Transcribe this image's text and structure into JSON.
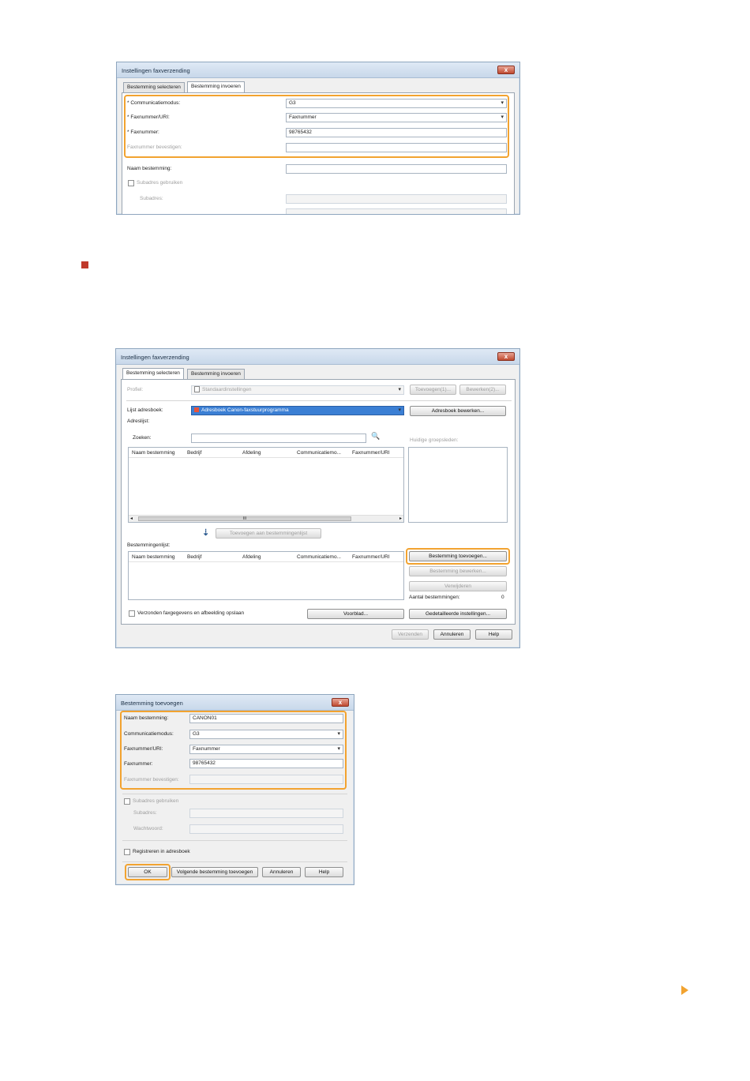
{
  "dialog1": {
    "title": "Instellingen faxverzending",
    "close": "x",
    "tabs": [
      "Bestemming selecteren",
      "Bestemming invoeren"
    ],
    "rows": [
      {
        "label": "* Communicatiemodus:",
        "value": "G3"
      },
      {
        "label": "* Faxnummer/URI:",
        "value": "Faxnummer"
      },
      {
        "label": "* Faxnummer:",
        "value": "98765432"
      },
      {
        "label": "Faxnummer bevestigen:",
        "value": ""
      }
    ],
    "naam_label": "Naam bestemming:",
    "subadres_check": "Subadres gebruiken",
    "subadres_label": "Subadres:"
  },
  "dialog2": {
    "title": "Instellingen faxverzending",
    "close": "x",
    "tabs": [
      "Bestemming selecteren",
      "Bestemming invoeren"
    ],
    "profiel_label": "Profiel:",
    "profiel_value": "Standaardinstellingen",
    "toevoegen_btn": "Toevoegen(1)...",
    "bewerken_btn": "Bewerken(2)...",
    "lijst_label": "Lijst adresboek:",
    "lijst_value": "Adresboek Canon-faxstuurprogramma",
    "adresboek_btn": "Adresboek bewerken...",
    "adreslijst_label": "Adreslijst:",
    "zoeken_label": "Zoeken:",
    "huidige_label": "Huidige groepsleden:",
    "columns": [
      "Naam bestemming",
      "Bedrijf",
      "Afdeling",
      "Communicatiemo...",
      "Faxnummer/URI"
    ],
    "scroll_mid": "III",
    "toevoegen_lijst_btn": "Toevoegen aan bestemmingenlijst",
    "bestemmingenlijst_label": "Bestemmingenlijst:",
    "columns2": [
      "Naam bestemming",
      "Bedrijf",
      "Afdeling",
      "Communicatiemo...",
      "Faxnummer/URI"
    ],
    "bestemming_toevoegen_btn": "Bestemming toevoegen...",
    "bestemming_bewerken_btn": "Bestemming bewerken...",
    "verwijderen_btn": "Verwijderen",
    "aantal_label": "Aantal bestemmingen:",
    "aantal_value": "0",
    "opslaan_check": "Verzonden faxgegevens en afbeelding opslaan",
    "voorblad_btn": "Voorblad...",
    "gedetailleerde_btn": "Gedetailleerde instellingen...",
    "verzenden_btn": "Verzenden",
    "annuleren_btn": "Annuleren",
    "help_btn": "Help"
  },
  "dialog3": {
    "title": "Bestemming toevoegen",
    "close": "x",
    "rows": [
      {
        "label": "Naam bestemming:",
        "value": "CANON01"
      },
      {
        "label": "Communicatiemodus:",
        "value": "G3"
      },
      {
        "label": "Faxnummer/URI:",
        "value": "Faxnummer"
      },
      {
        "label": "Faxnummer:",
        "value": "98765432"
      },
      {
        "label": "Faxnummer bevestigen:",
        "value": ""
      }
    ],
    "subadres_check": "Subadres gebruiken",
    "subadres_label": "Subadres:",
    "wachtwoord_label": "Wachtwoord:",
    "registreren_check": "Registreren in adresboek",
    "ok_btn": "OK",
    "volgende_btn": "Volgende bestemming toevoegen",
    "annuleren_btn": "Annuleren",
    "help_btn": "Help"
  },
  "colors": {
    "highlight": "#f2a330",
    "bullet": "#c0392b",
    "selection": "#3b7fd4"
  }
}
